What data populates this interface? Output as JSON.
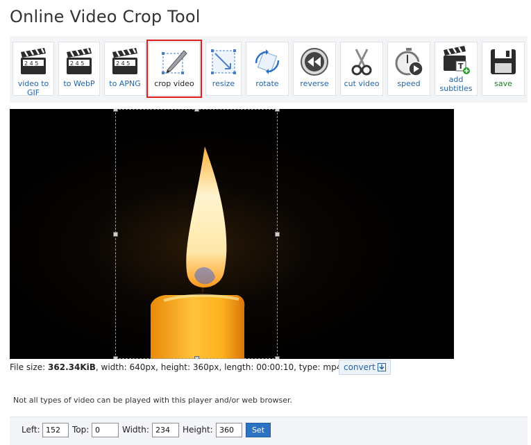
{
  "page": {
    "title": "Online Video Crop Tool"
  },
  "toolbar": {
    "tools": [
      {
        "label": "video to GIF",
        "icon": "clapperboard-icon"
      },
      {
        "label": "to WebP",
        "icon": "clapperboard-icon"
      },
      {
        "label": "to APNG",
        "icon": "clapperboard-icon"
      },
      {
        "label": "crop video",
        "icon": "crop-pen-icon"
      },
      {
        "label": "resize",
        "icon": "resize-icon"
      },
      {
        "label": "rotate",
        "icon": "rotate-icon"
      },
      {
        "label": "reverse",
        "icon": "rewind-icon"
      },
      {
        "label": "cut video",
        "icon": "scissors-icon"
      },
      {
        "label": "speed",
        "icon": "stopwatch-icon"
      },
      {
        "label": "add subtitles",
        "icon": "clapperboard-subtitle-icon"
      },
      {
        "label": "save",
        "icon": "floppy-disk-icon"
      }
    ],
    "active_tool": "crop video"
  },
  "fileinfo": {
    "prefix": "File size: ",
    "size": "362.34KiB",
    "rest": ", width: 640px, height: 360px, length: 00:00:10, type: mp4",
    "convert_label": "convert"
  },
  "note": "Not all types of video can be played with this player and/or web browser.",
  "crop": {
    "left_label": "Left:",
    "left": "152",
    "top_label": "Top:",
    "top": "0",
    "width_label": "Width:",
    "width": "234",
    "height_label": "Height:",
    "height": "360",
    "set_label": "Set"
  },
  "colors": {
    "accent": "#2d73c4",
    "active_outline": "#e01e1e",
    "link": "#1f63a8"
  }
}
